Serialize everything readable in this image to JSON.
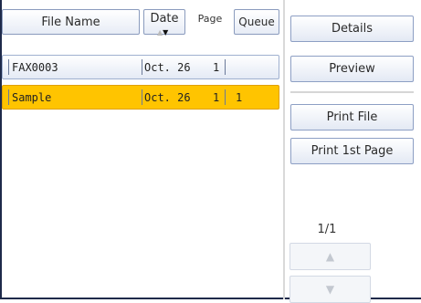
{
  "columns": {
    "file_name": "File Name",
    "date": "Date",
    "page": "Page",
    "queue": "Queue"
  },
  "sort_indicator": {
    "up": "▲",
    "down": "▼"
  },
  "rows": [
    {
      "name": "FAX0003",
      "date": "Oct. 26",
      "page": "1",
      "queue": "",
      "selected": false
    },
    {
      "name": "Sample",
      "date": "Oct. 26",
      "page": "1",
      "queue": "1",
      "selected": true
    }
  ],
  "panel": {
    "details": "Details",
    "preview": "Preview",
    "print_file": "Print File",
    "print_first_page": "Print 1st Page",
    "page_counter": "1/1",
    "scroll_up_icon": "▲",
    "scroll_down_icon": "▼"
  },
  "colors": {
    "selected_row": "#ffc400",
    "frame": "#1e2a4a",
    "button_border": "#8d9fc4"
  }
}
